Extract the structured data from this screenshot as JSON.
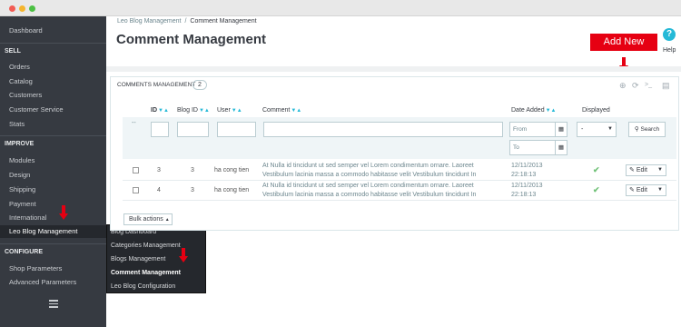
{
  "sidebar": {
    "dashboard": "Dashboard",
    "sections": [
      {
        "title": "SELL",
        "items": [
          "Orders",
          "Catalog",
          "Customers",
          "Customer Service",
          "Stats"
        ]
      },
      {
        "title": "IMPROVE",
        "items": [
          "Modules",
          "Design",
          "Shipping",
          "Payment",
          "International",
          "Leo Blog Management"
        ]
      },
      {
        "title": "CONFIGURE",
        "items": [
          "Shop Parameters",
          "Advanced Parameters"
        ]
      }
    ],
    "active_item": "Leo Blog Management",
    "menu_icon": "hamburger-icon"
  },
  "submenu": {
    "items": [
      "Blog Dashboard",
      "Categories Management",
      "Blogs Management",
      "Comment Management",
      "Leo Blog Configuration"
    ],
    "current": "Comment Management"
  },
  "header": {
    "breadcrumb": [
      "Leo Blog Management",
      "Comment Management"
    ],
    "breadcrumb_sep": "/",
    "title": "Comment Management",
    "add_new_label": "Add New",
    "help_icon_glyph": "?",
    "help_label": "Help"
  },
  "panel": {
    "title": "Comments Management",
    "count": "2",
    "tool_icons": [
      "add-icon",
      "refresh-icon",
      "sql-query-icon",
      "export-icon"
    ]
  },
  "table": {
    "columns": {
      "id": "ID",
      "blog_id": "Blog ID",
      "user": "User",
      "comment": "Comment",
      "date_added": "Date Added",
      "displayed": "Displayed"
    },
    "filter": {
      "dash": "--",
      "date_from_placeholder": "From",
      "date_to_placeholder": "To",
      "displayed_value": "-",
      "search_label": "Search"
    },
    "rows": [
      {
        "id": "3",
        "blog_id": "3",
        "user": "ha cong tien",
        "comment_line1": "At Nulla id tincidunt ut sed semper vel Lorem condimentum ornare. Laoreet",
        "comment_line2": "Vestibulum lacinia massa a commodo habitasse velit Vestibulum tincidunt In",
        "date": "12/11/2013",
        "time": "22:18:13",
        "displayed": true,
        "edit_label": "Edit"
      },
      {
        "id": "4",
        "blog_id": "3",
        "user": "ha cong tien",
        "comment_line1": "At Nulla id tincidunt ut sed semper vel Lorem condimentum ornare. Laoreet",
        "comment_line2": "Vestibulum lacinia massa a commodo habitasse velit Vestibulum tincidunt In",
        "date": "12/11/2013",
        "time": "22:18:13",
        "displayed": true,
        "edit_label": "Edit"
      }
    ],
    "bulk_actions_label": "Bulk actions"
  },
  "colors": {
    "sidebar_bg": "#363a41",
    "accent": "#25b9d7",
    "annotation_red": "#e60012",
    "success": "#72c279"
  }
}
